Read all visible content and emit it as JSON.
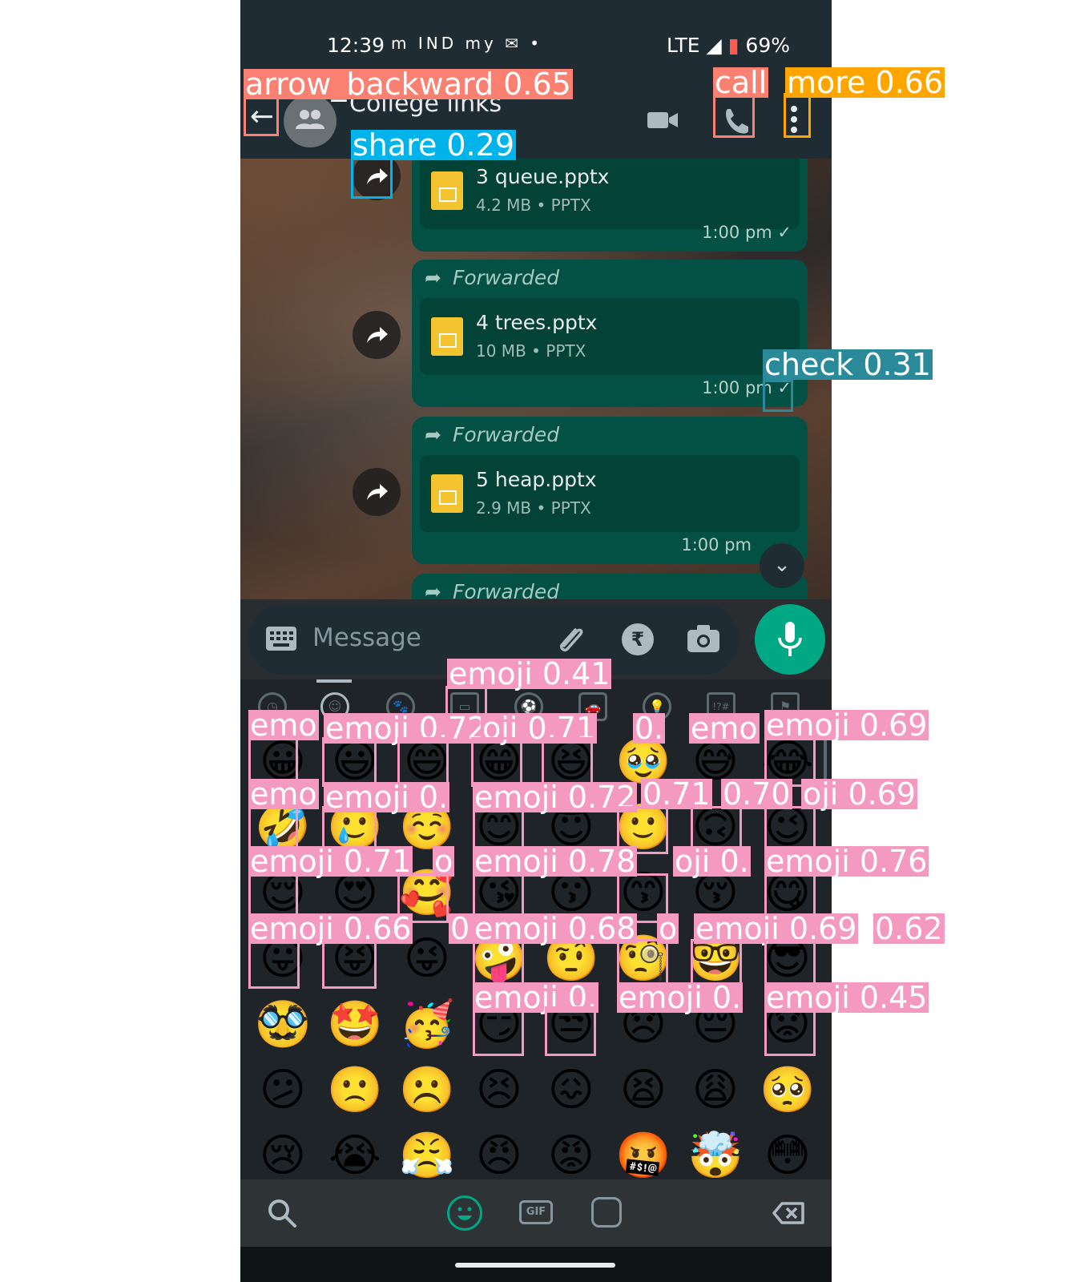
{
  "status_bar": {
    "time": "12:39",
    "icons": "m IND my ✉ •",
    "network": "LTE ◢",
    "battery": "69%"
  },
  "app_bar": {
    "title": "College links"
  },
  "messages": [
    {
      "forwarded": "",
      "file_name": "3 queue.pptx",
      "file_meta": "4.2 MB • PPTX",
      "time": "1:00 pm ✓"
    },
    {
      "forwarded": "Forwarded",
      "file_name": "4 trees.pptx",
      "file_meta": "10 MB • PPTX",
      "time": "1:00 pm ✓"
    },
    {
      "forwarded": "Forwarded",
      "file_name": "5 heap.pptx",
      "file_meta": "2.9 MB • PPTX",
      "time": "1:00 pm"
    },
    {
      "forwarded": "Forwarded"
    }
  ],
  "input": {
    "placeholder": "Message",
    "rupee": "₹"
  },
  "emoji_categories": [
    "recent",
    "smileys",
    "animals",
    "food",
    "activity",
    "travel",
    "objects",
    "symbols",
    "flags"
  ],
  "emoji_rows": [
    [
      "😀",
      "😃",
      "😄",
      "😁",
      "😆",
      "🥹",
      "😅",
      "😂"
    ],
    [
      "🤣",
      "🥲",
      "☺️",
      "😊",
      "😇",
      "🙂",
      "🙃",
      "😉"
    ],
    [
      "😌",
      "😍",
      "🥰",
      "😘",
      "😗",
      "😙",
      "😚",
      "😋"
    ],
    [
      "😛",
      "😝",
      "😜",
      "🤪",
      "🤨",
      "🧐",
      "🤓",
      "😎"
    ],
    [
      "🥸",
      "🤩",
      "🥳",
      "😏",
      "😒",
      "😞",
      "😔",
      "😟"
    ],
    [
      "😕",
      "🙁",
      "☹️",
      "😣",
      "😖",
      "😫",
      "😩",
      "🥺"
    ],
    [
      "😢",
      "😭",
      "😤",
      "😠",
      "😡",
      "🤬",
      "🤯",
      "😳"
    ]
  ],
  "keyboard_bar": {
    "gif": "GIF"
  },
  "detections": [
    {
      "label": "arrow_backward 0.65",
      "color": "#fa8072"
    },
    {
      "label": "call",
      "color": "#fa8072"
    },
    {
      "label": "more 0.66",
      "color": "#ffa500"
    },
    {
      "label": "share 0.29",
      "color": "#00b4eb"
    },
    {
      "label": "check 0.31",
      "color": "#2a8a9a"
    },
    {
      "label": "emoji 0.41",
      "color": "#f49ac1"
    },
    {
      "label": "emo",
      "color": "#f49ac1"
    },
    {
      "label": "emoji 0.72",
      "color": "#f49ac1"
    },
    {
      "label": "oji 0.71",
      "color": "#f49ac1"
    },
    {
      "label": "0.",
      "color": "#f49ac1"
    },
    {
      "label": "emo",
      "color": "#f49ac1"
    },
    {
      "label": "emoji 0.69",
      "color": "#f49ac1"
    },
    {
      "label": "emo",
      "color": "#f49ac1"
    },
    {
      "label": "emoji 0.",
      "color": "#f49ac1"
    },
    {
      "label": "emoji 0.72",
      "color": "#f49ac1"
    },
    {
      "label": "0.71",
      "color": "#f49ac1"
    },
    {
      "label": "0.70",
      "color": "#f49ac1"
    },
    {
      "label": "oji 0.69",
      "color": "#f49ac1"
    },
    {
      "label": "emoji 0.71",
      "color": "#f49ac1"
    },
    {
      "label": "o",
      "color": "#f49ac1"
    },
    {
      "label": "emoji 0.78",
      "color": "#f49ac1"
    },
    {
      "label": "oji 0.",
      "color": "#f49ac1"
    },
    {
      "label": "emoji 0.76",
      "color": "#f49ac1"
    },
    {
      "label": "emoji 0.66",
      "color": "#f49ac1"
    },
    {
      "label": "0.",
      "color": "#f49ac1"
    },
    {
      "label": "emoji 0.68",
      "color": "#f49ac1"
    },
    {
      "label": "o",
      "color": "#f49ac1"
    },
    {
      "label": "emoji 0.69",
      "color": "#f49ac1"
    },
    {
      "label": "0.62",
      "color": "#f49ac1"
    },
    {
      "label": "emoji 0.",
      "color": "#f49ac1"
    },
    {
      "label": "emoji 0.",
      "color": "#f49ac1"
    },
    {
      "label": "emoji 0.45",
      "color": "#f49ac1"
    }
  ]
}
